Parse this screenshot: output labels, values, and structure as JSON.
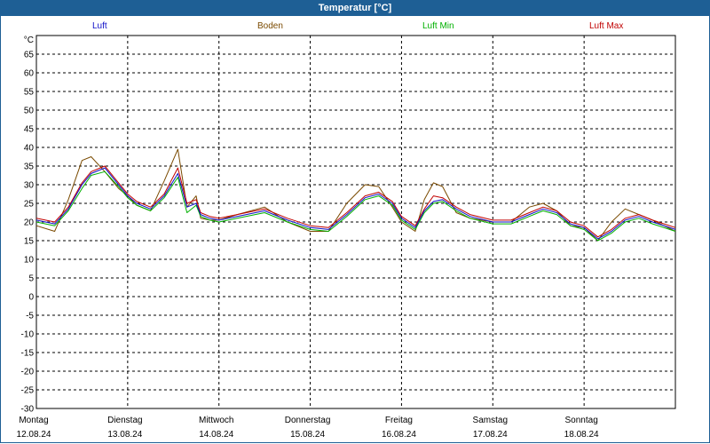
{
  "window": {
    "title": "Temperatur [°C]"
  },
  "colors": {
    "luft": "#1010c8",
    "boden": "#7a4a00",
    "luft_min": "#00b000",
    "luft_max": "#c00000",
    "titlebar": "#1e5f95"
  },
  "chart_data": {
    "type": "line",
    "title": "Temperatur [°C]",
    "ylabel": "°C",
    "ylim": [
      -30,
      70
    ],
    "yticks": [
      -30,
      -25,
      -20,
      -15,
      -10,
      -5,
      0,
      5,
      10,
      15,
      20,
      25,
      30,
      35,
      40,
      45,
      50,
      55,
      60,
      65
    ],
    "xlim": [
      0,
      7
    ],
    "grid": true,
    "legend_position": "top",
    "days": [
      {
        "name": "Montag",
        "date": "12.08.24"
      },
      {
        "name": "Dienstag",
        "date": "13.08.24"
      },
      {
        "name": "Mittwoch",
        "date": "14.08.24"
      },
      {
        "name": "Donnerstag",
        "date": "15.08.24"
      },
      {
        "name": "Freitag",
        "date": "16.08.24"
      },
      {
        "name": "Samstag",
        "date": "17.08.24"
      },
      {
        "name": "Sonntag",
        "date": "18.08.24"
      }
    ],
    "x": [
      0,
      0.2,
      0.35,
      0.5,
      0.6,
      0.75,
      0.9,
      1.0,
      1.1,
      1.25,
      1.4,
      1.55,
      1.65,
      1.75,
      1.8,
      1.9,
      2.0,
      2.2,
      2.5,
      2.75,
      3.0,
      3.2,
      3.4,
      3.6,
      3.75,
      3.9,
      4.0,
      4.15,
      4.25,
      4.35,
      4.45,
      4.6,
      4.75,
      5.0,
      5.2,
      5.4,
      5.55,
      5.7,
      5.85,
      6.0,
      6.15,
      6.3,
      6.45,
      6.6,
      6.75,
      7.0
    ],
    "series": [
      {
        "name": "Luft",
        "color": "#1010c8",
        "values": [
          20.5,
          19.5,
          23.5,
          30,
          33,
          34.5,
          30,
          27,
          25,
          23.5,
          27,
          33,
          24,
          25,
          22,
          21,
          20.5,
          21.5,
          23,
          20.5,
          18.5,
          18,
          22,
          26.5,
          27.5,
          25,
          21,
          18.5,
          23,
          25.5,
          26,
          23.5,
          21.5,
          20,
          20,
          22,
          23.5,
          22.5,
          19.5,
          18.5,
          15.5,
          17.5,
          20.5,
          21.5,
          20,
          18
        ]
      },
      {
        "name": "Boden",
        "color": "#7a4a00",
        "values": [
          19,
          17.5,
          26,
          36.5,
          37.5,
          33.5,
          29,
          27,
          24.5,
          23,
          31,
          39.5,
          24,
          27,
          21,
          20.5,
          20.5,
          22,
          24,
          20,
          17.5,
          17.5,
          25,
          30,
          29.5,
          24,
          20,
          17.5,
          26,
          30.5,
          29.5,
          22.5,
          21,
          20,
          20,
          24,
          25,
          23,
          19,
          18.5,
          15,
          20,
          23.5,
          22,
          20.5,
          17.5
        ]
      },
      {
        "name": "Luft Min",
        "color": "#00b000",
        "values": [
          20,
          19,
          23,
          29,
          32.5,
          33.5,
          29.5,
          26.5,
          24.5,
          23,
          26.5,
          32,
          22.5,
          24.5,
          21.5,
          20.5,
          20,
          21,
          22.5,
          20,
          18,
          17.5,
          21.5,
          26,
          27,
          24.5,
          20.5,
          18,
          22.5,
          25,
          25.5,
          23,
          21,
          19.5,
          19.5,
          21.5,
          23,
          22,
          19,
          18,
          15,
          17,
          20,
          21,
          19.5,
          17.5
        ]
      },
      {
        "name": "Luft Max",
        "color": "#c00000",
        "values": [
          21,
          20,
          24,
          30.5,
          33.5,
          35,
          30.5,
          27.5,
          25.5,
          24,
          27.5,
          34.5,
          25,
          26,
          22.5,
          21.5,
          21,
          22,
          23.5,
          21,
          19,
          18.5,
          22.5,
          27,
          28,
          25.5,
          21.5,
          19,
          23.5,
          27,
          26.5,
          24,
          22,
          20.5,
          20.5,
          22.5,
          24,
          23,
          20,
          19,
          16,
          18,
          21,
          22,
          20.5,
          18.5
        ]
      }
    ]
  }
}
